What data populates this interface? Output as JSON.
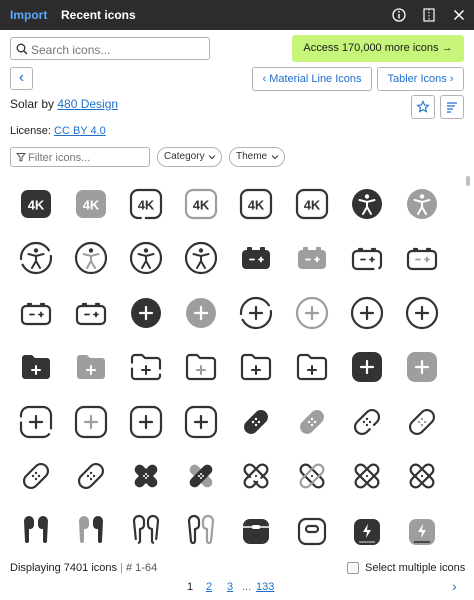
{
  "tabs": {
    "import": "Import",
    "recent": "Recent icons"
  },
  "search": {
    "placeholder": "Search icons..."
  },
  "access_button": "Access 170,000 more icons →",
  "nav": {
    "back": "‹",
    "prev_label": "Material Line Icons",
    "next_label": "Tabler Icons"
  },
  "set": {
    "name": "Solar by ",
    "author": "480 Design",
    "license_label": "License: ",
    "license": "CC BY 4.0"
  },
  "filter": {
    "placeholder": "Filter icons...",
    "category": "Category",
    "theme": "Theme"
  },
  "footer": {
    "count": "Displaying 7401 icons",
    "separator": "|",
    "range": "# 1-64",
    "select_multiple": "Select multiple icons"
  },
  "pagination": {
    "p1": "1",
    "p2": "2",
    "p3": "3",
    "ellipsis": "...",
    "last": "133",
    "next": "›"
  },
  "icons": [
    "4k-bold",
    "4k-bold-duotone",
    "4k-line",
    "4k-line-duotone",
    "4k-outline",
    "4k-linear",
    "accessibility-bold",
    "accessibility-bold-duotone",
    "accessibility-broken",
    "accessibility-line-duotone",
    "accessibility-outline",
    "accessibility-linear",
    "battery-bold",
    "battery-bold-duotone",
    "battery-broken",
    "battery-line-duotone",
    "battery-outline",
    "battery-linear",
    "add-circle-bold",
    "add-circle-bold-duotone",
    "add-circle-broken",
    "add-circle-line-duotone",
    "add-circle-outline",
    "add-circle-linear",
    "add-folder-bold",
    "add-folder-bold-duotone",
    "add-folder-broken",
    "add-folder-line-duotone",
    "add-folder-outline",
    "add-folder-linear",
    "add-square-bold",
    "add-square-bold-duotone",
    "add-square-broken",
    "add-square-line-duotone",
    "add-square-outline",
    "add-square-linear",
    "bandage-bold",
    "bandage-bold-duotone",
    "bandage-broken",
    "bandage-line-duotone",
    "bandage-outline",
    "bandage-linear",
    "bandages-bold",
    "bandages-bold-duotone",
    "bandages-broken",
    "bandages-line-duotone",
    "bandages-outline",
    "bandages-linear",
    "airbuds-bold",
    "airbuds-bold-duotone",
    "airbuds-broken",
    "airbuds-line-duotone",
    "airbuds-case-bold",
    "airbuds-case-outline",
    "airbuds-charge-bold",
    "airbuds-charge-bold-duotone"
  ],
  "colors": {
    "accent": "#1f6fcc",
    "topbar": "#2c2c2c",
    "active_tab": "#5aa9ff",
    "promo": "#c6f57a",
    "icon_dark": "#333333",
    "icon_gray": "#9e9e9e"
  }
}
